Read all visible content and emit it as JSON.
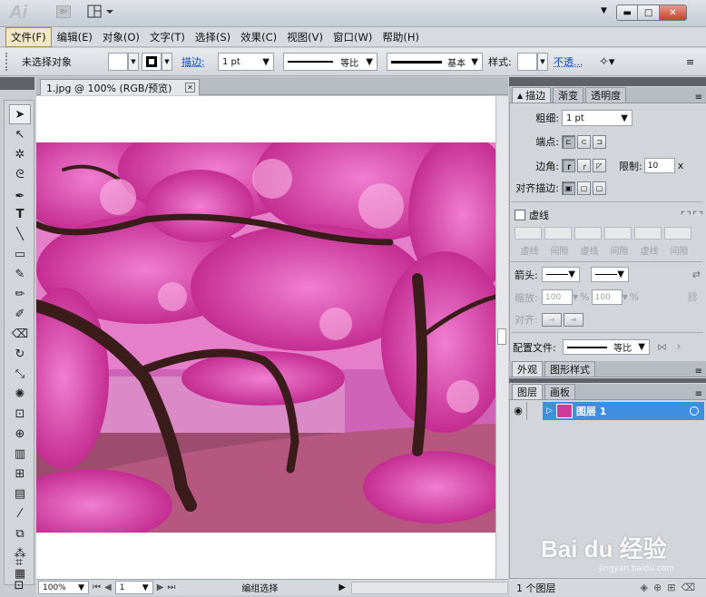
{
  "app": {
    "logo": "Ai",
    "bridge": "Br",
    "workspace_arrow": "▼"
  },
  "window": {
    "minimize": "▬",
    "restore": "□",
    "close": "✕"
  },
  "menus": [
    "文件(F)",
    "编辑(E)",
    "对象(O)",
    "文字(T)",
    "选择(S)",
    "效果(C)",
    "视图(V)",
    "窗口(W)",
    "帮助(H)"
  ],
  "control": {
    "selection_status": "未选择对象",
    "stroke_label": "描边:",
    "stroke_weight": "1 pt",
    "stroke_profile": "等比",
    "brush": "基本",
    "style_label": "样式:",
    "opacity_link": "不透..."
  },
  "document": {
    "tab_title": "1.jpg @ 100% (RGB/预览)",
    "tab_close": "✕"
  },
  "status": {
    "zoom": "100%",
    "page": "1",
    "mode": "编组选择"
  },
  "stroke_panel": {
    "tabs": [
      "描边",
      "渐变",
      "透明度"
    ],
    "weight_label": "粗细:",
    "weight": "1 pt",
    "cap_label": "端点:",
    "corner_label": "边角:",
    "limit_label": "限制:",
    "limit": "10",
    "limit_unit": "x",
    "align_label": "对齐描边:",
    "dashed_label": "虚线",
    "dash_labels": [
      "虚线",
      "间隙",
      "虚线",
      "间隙",
      "虚线",
      "间隙"
    ],
    "arrow_label": "箭头:",
    "scale_label": "缩放:",
    "scale1": "100",
    "scale2": "100",
    "pct": "%",
    "align2_label": "对齐:",
    "profile_label": "配置文件:",
    "profile": "等比"
  },
  "appearance_panel": {
    "tabs": [
      "外观",
      "图形样式"
    ]
  },
  "layers_panel": {
    "tabs": [
      "图层",
      "画板"
    ],
    "layer_name": "图层 1",
    "footer": "1 个图层"
  },
  "watermark": {
    "text": "Bai du 经验",
    "url": "jingyan.baidu.com"
  },
  "colors": {
    "selection": "#3f8fe0",
    "blossom": "#d2399e",
    "trunk": "#3a1d1a",
    "water": "#c75cb0"
  }
}
